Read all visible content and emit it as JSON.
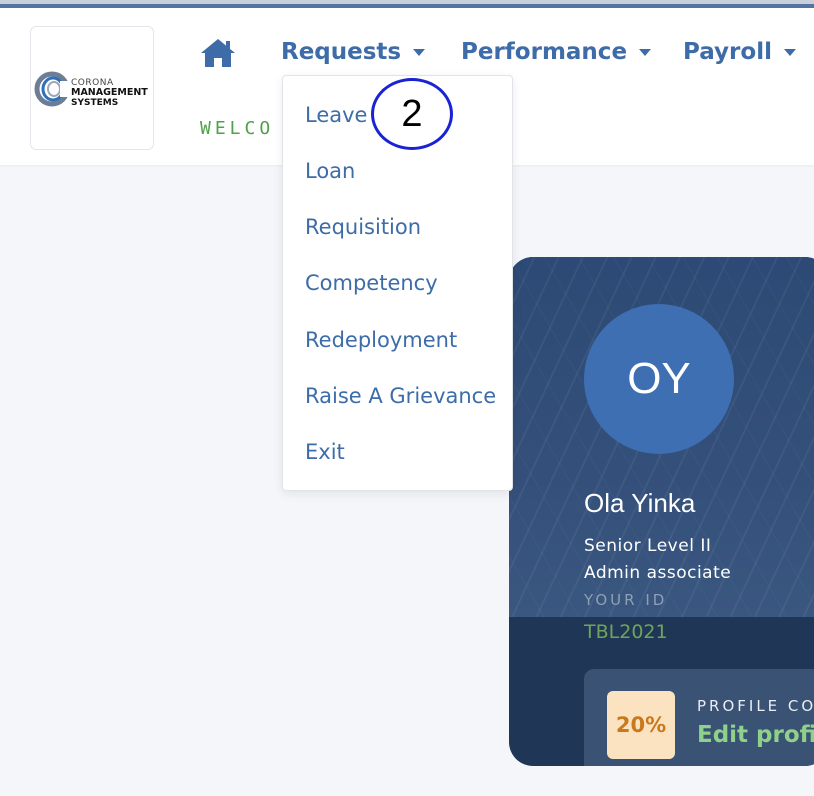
{
  "brand": {
    "line1": "CORONA",
    "line2": "MANAGEMENT",
    "line3": "SYSTEMS"
  },
  "nav": {
    "home_icon": "home-icon",
    "items": [
      {
        "label": "Requests"
      },
      {
        "label": "Performance"
      },
      {
        "label": "Payroll"
      }
    ],
    "welcome_text": "WELCO"
  },
  "dropdown": {
    "items": [
      {
        "label": "Leave"
      },
      {
        "label": "Loan"
      },
      {
        "label": "Requisition"
      },
      {
        "label": "Competency"
      },
      {
        "label": "Redeployment"
      },
      {
        "label": "Raise A Grievance"
      },
      {
        "label": "Exit"
      }
    ]
  },
  "annotation": {
    "label": "2"
  },
  "profile": {
    "initials": "OY",
    "name": "Ola Yinka",
    "level": "Senior Level II",
    "role": "Admin associate",
    "id_label": "YOUR ID",
    "id_value": "TBL2021",
    "completion_percent": "20%",
    "completion_label": "PROFILE CO",
    "edit_link": "Edit profil"
  },
  "colors": {
    "accent": "#3d6ca8",
    "welcome": "#4fa14a",
    "annotation_ring": "#1a23d4",
    "card_bg": "#1f3657",
    "id_green": "#6fa55a",
    "edit_green": "#8fd08a",
    "badge_bg": "#fbe3c2",
    "badge_text": "#c9781b"
  }
}
